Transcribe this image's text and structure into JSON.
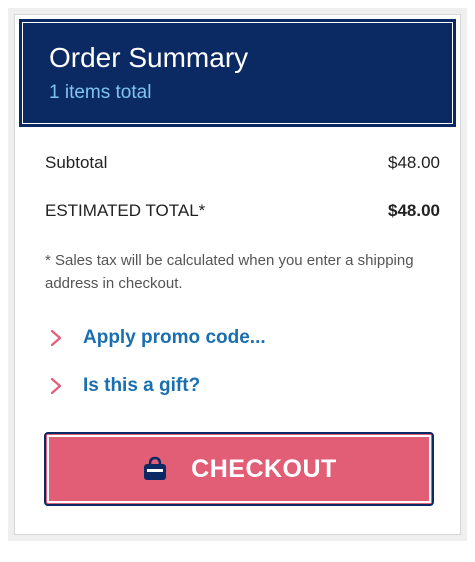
{
  "header": {
    "title": "Order Summary",
    "subtitle": "1 items total"
  },
  "summary": {
    "subtotal_label": "Subtotal",
    "subtotal_value": "$48.00",
    "total_label": "ESTIMATED TOTAL*",
    "total_value": "$48.00",
    "tax_note": "* Sales tax will be calculated when you enter a shipping address in checkout."
  },
  "links": {
    "promo": "Apply promo code...",
    "gift": "Is this a gift?"
  },
  "checkout": {
    "label": "CHECKOUT",
    "icon": "bag-icon"
  },
  "colors": {
    "header_bg": "#0b2a63",
    "header_sub": "#7fc3f0",
    "link": "#1a6fb0",
    "chevron": "#e25e76",
    "checkout_bg": "#e25e76"
  }
}
